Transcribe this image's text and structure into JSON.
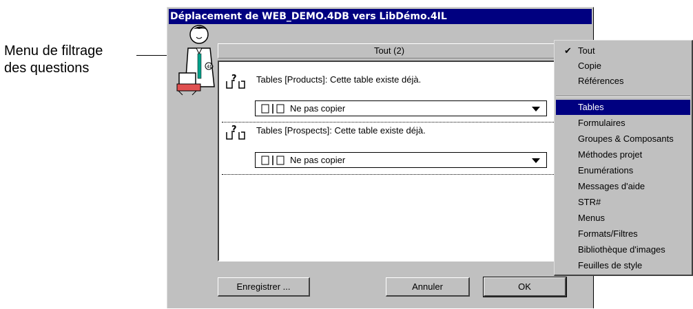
{
  "callout": {
    "line1": "Menu de filtrage",
    "line2": "des questions"
  },
  "window": {
    "title": "Déplacement de WEB_DEMO.4DB vers LibDémo.4IL"
  },
  "filter": {
    "label": "Tout (2)"
  },
  "questions": [
    {
      "text": "Tables [Products]: Cette table existe déjà.",
      "option": "Ne pas copier"
    },
    {
      "text": "Tables [Prospects]: Cette table existe déjà.",
      "option": "Ne pas copier"
    }
  ],
  "buttons": {
    "save": "Enregistrer ...",
    "cancel": "Annuler",
    "ok": "OK"
  },
  "menu": {
    "checked": "Tout",
    "items": [
      "Tout",
      "Copie",
      "Références",
      "Tables",
      "Formulaires",
      "Groupes & Composants",
      "Méthodes projet",
      "Enumérations",
      "Messages d'aide",
      "STR#",
      "Menus",
      "Formats/Filtres",
      "Bibliothèque d'images",
      "Feuilles de style"
    ],
    "selected": "Tables",
    "check_glyph": "✔"
  },
  "colors": {
    "titlebar": "#000080",
    "selection": "#000080",
    "face": "#c0c0c0"
  },
  "icons": {
    "question": "question-link-icon",
    "docs": "document-copy-icon",
    "mascot": "assistant-mascot-icon"
  }
}
